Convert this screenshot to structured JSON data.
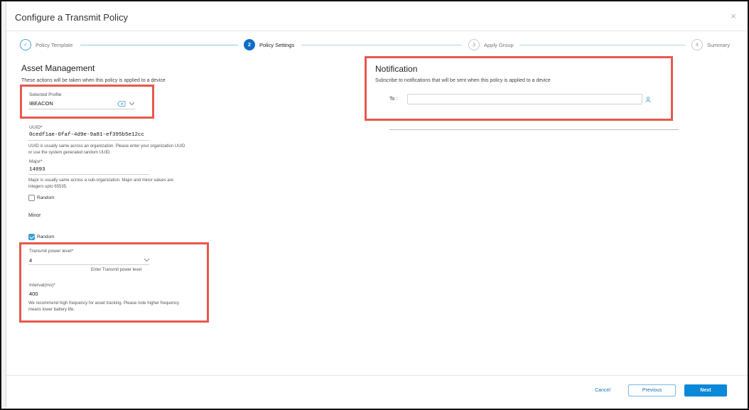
{
  "dialog": {
    "title": "Configure a Transmit Policy",
    "close_glyph": "×"
  },
  "wizard": {
    "steps": [
      {
        "number": "✓",
        "label": "Policy Template",
        "state": "done"
      },
      {
        "number": "2",
        "label": "Policy Settings",
        "state": "active"
      },
      {
        "number": "3",
        "label": "Apply Group",
        "state": "pending"
      },
      {
        "number": "4",
        "label": "Summary",
        "state": "pending"
      }
    ]
  },
  "asset": {
    "title": "Asset Management",
    "subtitle": "These actions will be taken when this policy is applied to a device",
    "profile": {
      "label": "Selected Profile",
      "value": "IBEACON"
    },
    "uuid": {
      "label": "UUID*",
      "value": "0cedf1ae-0faf-4d9e-9a81-ef395b5e12cc",
      "help_line1": "UUID is usually same across an organization. Please enter your organization UUID",
      "help_line2": "or use the system generated random UUID."
    },
    "major": {
      "label": "Major*",
      "value": "14093",
      "help_line1": "Major is usually same across a sub-organization. Major and minor values are",
      "help_line2": "integers upto 65535.",
      "random_label": "Random",
      "random_checked": false
    },
    "minor": {
      "label": "Minor",
      "random_label": "Random",
      "random_checked": true
    },
    "transmit_power": {
      "label": "Transmit power level*",
      "value": "4",
      "hint": "Enter Transmit power level"
    },
    "interval": {
      "label": "Interval(ms)*",
      "value": "400",
      "help_line1": "We recommend high frequency for asset tracking. Please note higher frequency",
      "help_line2": "means lower battery life."
    }
  },
  "notification": {
    "title": "Notification",
    "subtitle": "Subscribe to notifications that will be sent when this policy is applied to a device",
    "to_label": "To :",
    "to_value": ""
  },
  "footer": {
    "cancel": "Cancel",
    "previous": "Previous",
    "next": "Next"
  },
  "colors": {
    "accent": "#0a88d9",
    "highlight": "#e8584c"
  },
  "icons": [
    "check-icon",
    "close-icon",
    "clear-icon",
    "chevron-down-icon",
    "person-icon"
  ]
}
